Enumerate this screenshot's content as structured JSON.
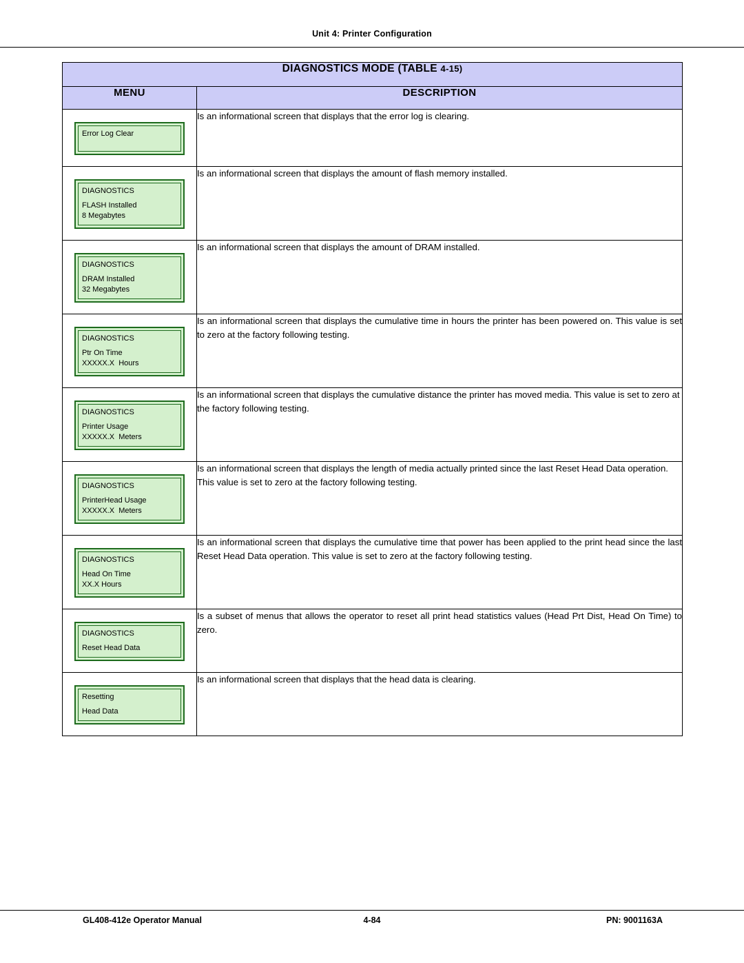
{
  "header": {
    "running_head": "Unit 4:  Printer Configuration"
  },
  "table": {
    "title_main": "DIAGNOSTICS MODE (TABLE ",
    "title_ref": "4-15)",
    "col_menu": "MENU",
    "col_description": "DESCRIPTION",
    "rows": [
      {
        "lcd": {
          "line1": "Error Log Clear",
          "line2": "",
          "line3": ""
        },
        "description": "Is an informational screen that displays that the error log is clearing.",
        "align": "left"
      },
      {
        "lcd": {
          "line1": "DIAGNOSTICS",
          "line2": "FLASH Installed",
          "line3": "8 Megabytes"
        },
        "description": "Is an informational screen that displays the amount of flash memory installed.",
        "align": "left"
      },
      {
        "lcd": {
          "line1": "DIAGNOSTICS",
          "line2": "DRAM Installed",
          "line3": "32 Megabytes"
        },
        "description": "Is an informational screen that displays the amount of DRAM installed.",
        "align": "left"
      },
      {
        "lcd": {
          "line1": "DIAGNOSTICS",
          "line2": "Ptr On Time",
          "line3": "XXXXX.X  Hours"
        },
        "description": "Is an informational screen that displays the cumulative time in hours the printer has been powered on. This value is set to zero at the factory following testing.",
        "align": "justify"
      },
      {
        "lcd": {
          "line1": "DIAGNOSTICS",
          "line2": "Printer Usage",
          "line3": "XXXXX.X  Meters"
        },
        "description": "Is an informational screen that displays the cumulative distance the printer has moved media. This value is set to zero at the factory following testing.",
        "align": "left"
      },
      {
        "lcd": {
          "line1": "DIAGNOSTICS",
          "line2": "PrinterHead Usage",
          "line3": "XXXXX.X  Meters"
        },
        "description": "Is an informational screen that displays the length of media actually printed since the last Reset Head Data operation. This value is set to zero at the factory following testing.",
        "align": "left"
      },
      {
        "lcd": {
          "line1": "DIAGNOSTICS",
          "line2": "Head On Time",
          "line3": "XX.X Hours"
        },
        "description": "Is an informational screen that displays the cumulative time that power has been applied to the print head since the last Reset Head Data operation. This value is set to zero at the factory following testing.",
        "align": "justify"
      },
      {
        "lcd": {
          "line1": "DIAGNOSTICS",
          "line2": "Reset Head Data",
          "line3": ""
        },
        "description": "Is a subset of menus that allows the operator to reset all print head statistics values (Head Prt Dist, Head On Time) to zero.",
        "align": "justify"
      },
      {
        "lcd": {
          "line1": "Resetting",
          "line2": "Head Data",
          "line3": ""
        },
        "description": "Is an informational screen that displays that the head data is clearing.",
        "align": "left"
      }
    ]
  },
  "footer": {
    "manual": "GL408-412e Operator Manual",
    "page": "4-84",
    "part_number": "PN: 9001163A"
  }
}
